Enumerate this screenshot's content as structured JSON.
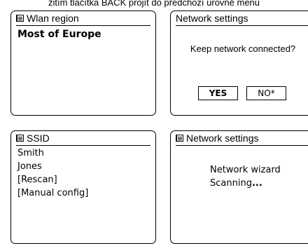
{
  "caption": "žitím tlačítka BACK projít do předchozí úrovně menu",
  "panels": {
    "wlan_region": {
      "title": "Wlan region",
      "selected": "Most of Europe"
    },
    "network_settings_confirm": {
      "title": "Network settings",
      "prompt": "Keep network connected?",
      "yes_label": "YES",
      "no_label": "NO*"
    },
    "ssid": {
      "title": "SSID",
      "items": [
        "Smith",
        "Jones",
        "[Rescan]",
        "[Manual config]"
      ]
    },
    "network_settings_wizard": {
      "title": "Network settings",
      "line1": "Network wizard",
      "line2": "Scanning",
      "line2_dots": "..."
    }
  },
  "icons": {
    "menu": "menu-list-icon"
  }
}
